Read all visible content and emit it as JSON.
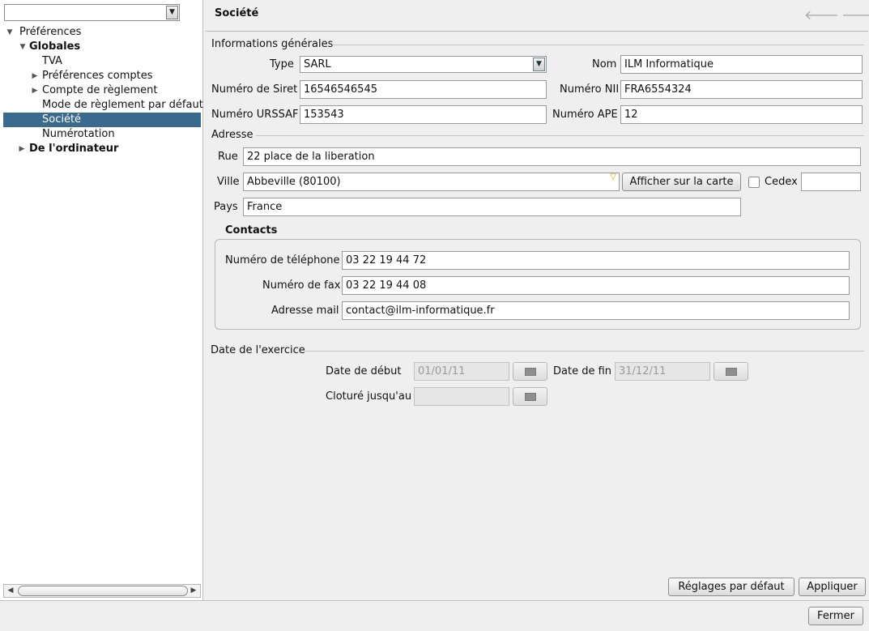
{
  "sidebar": {
    "combo_value": "",
    "tree": [
      {
        "label": "Préférences",
        "expanded": true
      },
      {
        "label": "Globales",
        "expanded": true
      },
      {
        "label": "TVA"
      },
      {
        "label": "Préférences comptes",
        "expanded": false
      },
      {
        "label": "Compte de règlement",
        "expanded": false
      },
      {
        "label": "Mode de règlement par défaut"
      },
      {
        "label": "Société",
        "selected": true
      },
      {
        "label": "Numérotation"
      },
      {
        "label": "De l'ordinateur",
        "expanded": false
      }
    ]
  },
  "header": {
    "title": "Société",
    "back_icon": "arrow-left-icon",
    "forward_icon": "arrow-right-icon"
  },
  "general": {
    "section_title": "Informations générales",
    "type_label": "Type",
    "type_value": "SARL",
    "nom_label": "Nom",
    "nom_value": "ILM Informatique",
    "siret_label": "Numéro de Siret",
    "siret_value": "16546546545",
    "nii_label": "Numéro NII",
    "nii_value": "FRA6554324",
    "urssaf_label": "Numéro URSSAF",
    "urssaf_value": "153543",
    "ape_label": "Numéro APE",
    "ape_value": "12"
  },
  "address": {
    "section_title": "Adresse",
    "rue_label": "Rue",
    "rue_value": "22 place de la liberation",
    "ville_label": "Ville",
    "ville_value": "Abbeville (80100)",
    "map_button": "Afficher sur la carte",
    "cedex_label": "Cedex",
    "cedex_checked": false,
    "cedex_value": "",
    "pays_label": "Pays",
    "pays_value": "France"
  },
  "contacts": {
    "title": "Contacts",
    "phone_label": "Numéro de téléphone",
    "phone_value": "03 22 19 44 72",
    "fax_label": "Numéro de fax",
    "fax_value": "03 22 19 44 08",
    "mail_label": "Adresse mail",
    "mail_value": "contact@ilm-informatique.fr"
  },
  "exercise": {
    "section_title": "Date de l'exercice",
    "start_label": "Date de début",
    "start_value": "01/01/11",
    "end_label": "Date de fin",
    "end_value": "31/12/11",
    "closed_label": "Cloturé jusqu'au",
    "closed_value": ""
  },
  "actions": {
    "defaults_button": "Réglages par défaut",
    "apply_button": "Appliquer",
    "close_button": "Fermer"
  }
}
